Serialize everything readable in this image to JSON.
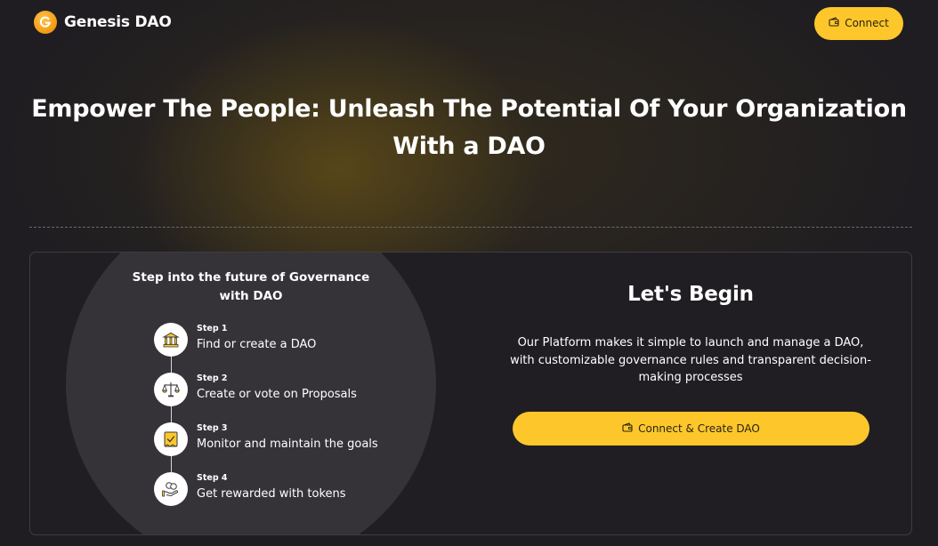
{
  "brand": {
    "name": "Genesis DAO",
    "logo_icon": "genesis-logo-icon"
  },
  "header": {
    "connect_label": "Connect",
    "connect_icon": "wallet-icon"
  },
  "hero": {
    "title_line1": "Empower The People: Unleash The Potential Of Your Organization",
    "title_line2": "With a DAO"
  },
  "steps_panel": {
    "title_line1": "Step into the future of Governance",
    "title_line2": "with DAO",
    "steps": [
      {
        "label": "Step 1",
        "text": "Find or create a DAO",
        "icon": "bank-icon"
      },
      {
        "label": "Step 2",
        "text": "Create or vote on Proposals",
        "icon": "scales-icon"
      },
      {
        "label": "Step 3",
        "text": "Monitor and maintain the goals",
        "icon": "checklist-icon"
      },
      {
        "label": "Step 4",
        "text": "Get rewarded with tokens",
        "icon": "coins-hand-icon"
      }
    ]
  },
  "begin": {
    "title": "Let's Begin",
    "desc_line1": "Our Platform makes it simple to launch and manage a DAO,",
    "desc_line2": "with customizable governance rules and transparent decision-",
    "desc_line3": "making processes",
    "cta_label": "Connect & Create DAO"
  },
  "colors": {
    "accent": "#fdc72b",
    "background": "#1f1d21",
    "card": "#201e23",
    "circle": "#353338"
  }
}
